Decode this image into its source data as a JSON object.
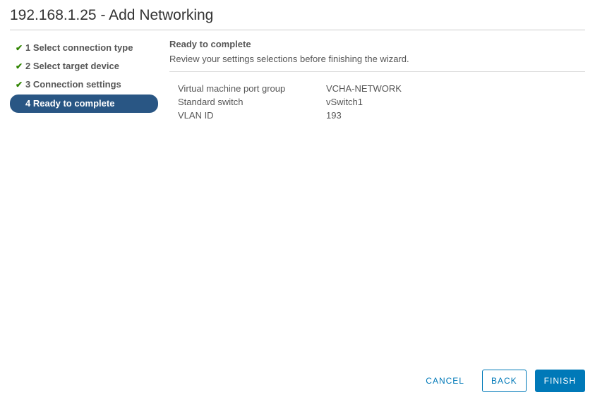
{
  "dialog": {
    "title": "192.168.1.25 - Add Networking"
  },
  "sidebar": {
    "steps": [
      {
        "label": "1 Select connection type",
        "completed": true,
        "active": false
      },
      {
        "label": "2 Select target device",
        "completed": true,
        "active": false
      },
      {
        "label": "3 Connection settings",
        "completed": true,
        "active": false
      },
      {
        "label": "4 Ready to complete",
        "completed": false,
        "active": true
      }
    ]
  },
  "main": {
    "title": "Ready to complete",
    "description": "Review your settings selections before finishing the wizard.",
    "summary": [
      {
        "key": "Virtual machine port group",
        "value": "VCHA-NETWORK"
      },
      {
        "key": "Standard switch",
        "value": "vSwitch1"
      },
      {
        "key": "VLAN ID",
        "value": "193"
      }
    ]
  },
  "footer": {
    "cancel": "CANCEL",
    "back": "BACK",
    "finish": "FINISH"
  }
}
